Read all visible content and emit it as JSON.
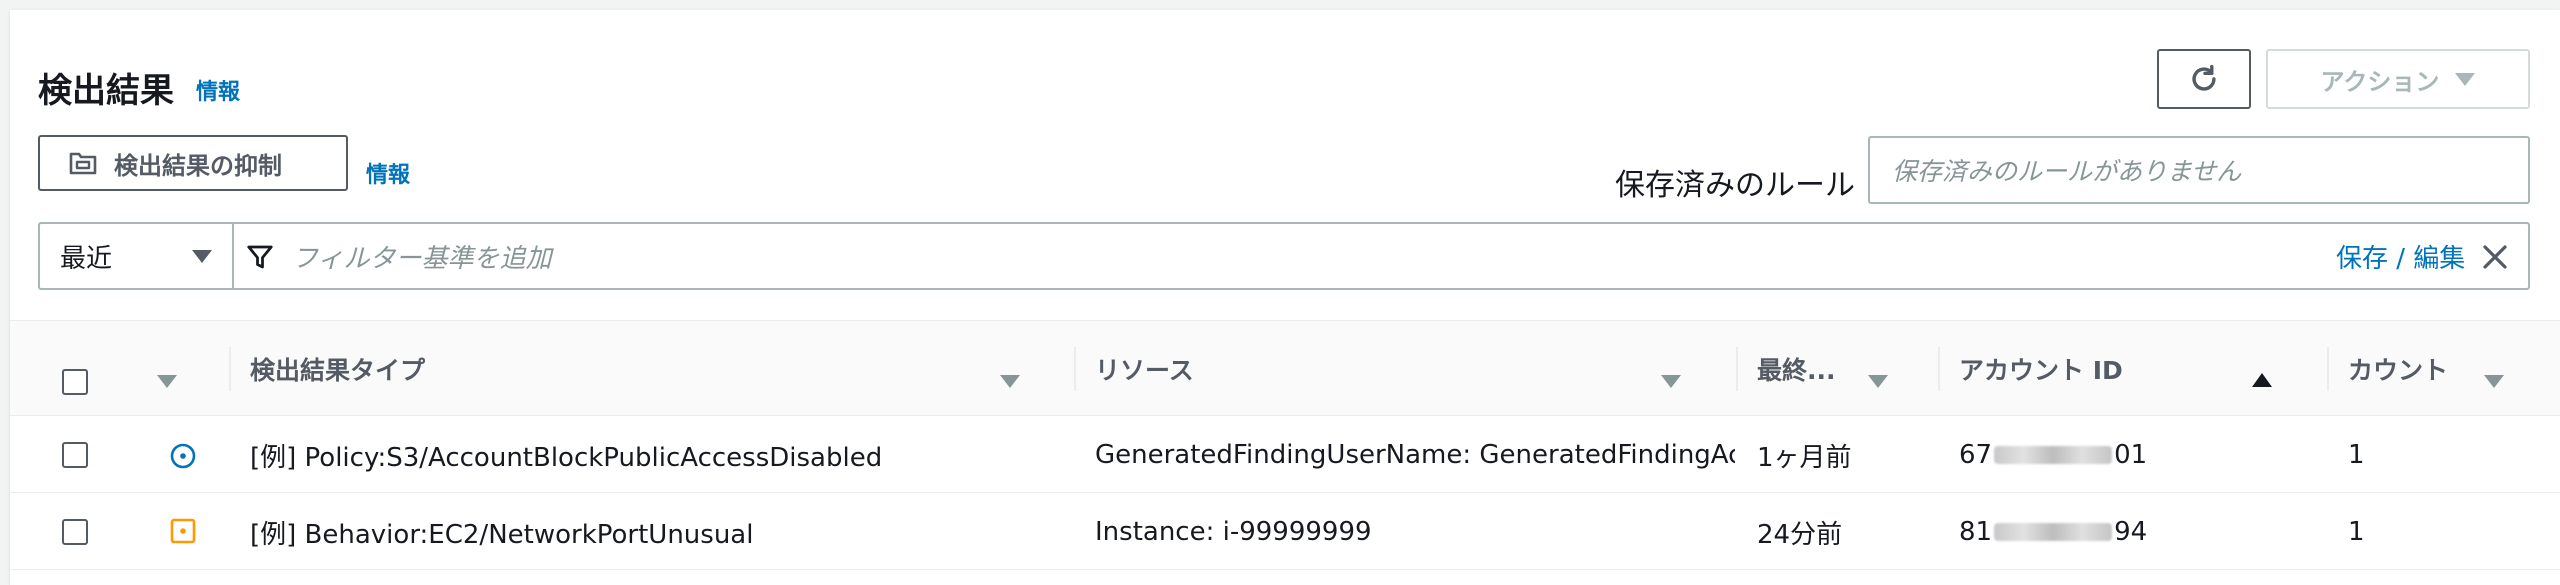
{
  "header": {
    "title": "検出結果",
    "info_label": "情報"
  },
  "toolbar": {
    "actions_label": "アクション",
    "suppress_label": "検出結果の抑制",
    "suppress_info_label": "情報"
  },
  "saved_rules": {
    "label": "保存済みのルール",
    "placeholder": "保存済みのルールがありません"
  },
  "filter": {
    "selected_value": "最近",
    "placeholder": "フィルター基準を追加",
    "save_edit_label": "保存 / 編集"
  },
  "table": {
    "columns": {
      "finding_type": "検出結果タイプ",
      "resource": "リソース",
      "last_seen": "最終...",
      "account_id": "アカウント ID",
      "count": "カウント"
    },
    "rows": [
      {
        "severity": "low",
        "severity_color": "#0073bb",
        "finding_type": "[例] Policy:S3/AccountBlockPublicAccessDisabled",
        "resource": "GeneratedFindingUserName: GeneratedFindingAccessKeyId",
        "last_seen": "1ヶ月前",
        "account_prefix": "67",
        "account_suffix": "01",
        "count": "1"
      },
      {
        "severity": "medium",
        "severity_color": "#ff9900",
        "finding_type": "[例] Behavior:EC2/NetworkPortUnusual",
        "resource": "Instance: i-99999999",
        "last_seen": "24分前",
        "account_prefix": "81",
        "account_suffix": "94",
        "count": "1"
      }
    ]
  }
}
